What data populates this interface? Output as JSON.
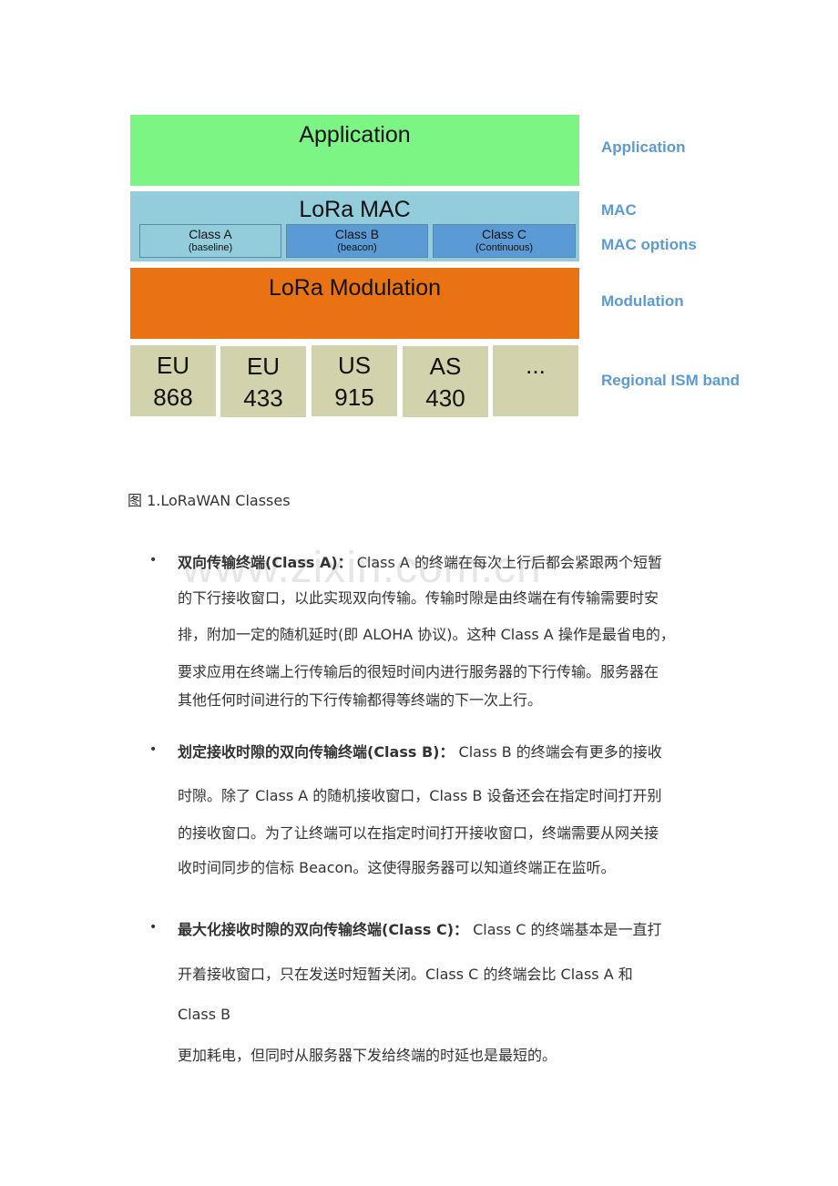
{
  "diagram": {
    "layers": {
      "application": "Application",
      "mac": "LoRa MAC",
      "modulation": "LoRa Modulation"
    },
    "classes": [
      {
        "name": "Class A",
        "sub": "(baseline)"
      },
      {
        "name": "Class B",
        "sub": "(beacon)"
      },
      {
        "name": "Class C",
        "sub": "(Continuous)"
      }
    ],
    "bands": [
      {
        "line1": "EU",
        "line2": "868"
      },
      {
        "line1": "EU",
        "line2": "433"
      },
      {
        "line1": "US",
        "line2": "915"
      },
      {
        "line1": "AS",
        "line2": "430"
      },
      {
        "line1": "...",
        "line2": ""
      }
    ],
    "side_labels": {
      "application": "Application",
      "mac": "MAC",
      "mac_options": "MAC options",
      "modulation": "Modulation",
      "regional": "Regional ISM band"
    },
    "colors": {
      "application": "#7cf584",
      "mac": "#93ccda",
      "class_highlight": "#5b9bd5",
      "modulation": "#e97312",
      "band": "#d2d3ac",
      "side_label": "#5b9bd5"
    }
  },
  "caption": "图 1.LoRaWAN Classes",
  "watermark": "www.zixin.com.cn",
  "bullets": [
    {
      "title": "双向传输终端(Class A)：",
      "lines": [
        " Class A  的终端在每次上行后都会紧跟两个短暂",
        "的下行接收窗口，以此实现双向传输。传输时隙是由终端在有传输需要时安",
        "排，附加一定的随机延时(即 ALOHA 协议)。这种 Class A  操作是最省电的，",
        "要求应用在终端上行传输后的很短时间内进行服务器的下行传输。服务器在",
        "其他任何时间进行的下行传输都得等终端的下一次上行。"
      ]
    },
    {
      "title": "划定接收时隙的双向传输终端(Class B)：",
      "lines": [
        " Class B  的终端会有更多的接收",
        "时隙。除了 Class A  的随机接收窗口，Class B  设备还会在指定时间打开别",
        "的接收窗口。为了让终端可以在指定时间打开接收窗口，终端需要从网关接",
        "收时间同步的信标  Beacon。这使得服务器可以知道终端正在监听。"
      ]
    },
    {
      "title": "最大化接收时隙的双向传输终端(Class C)：",
      "lines": [
        " Class C  的终端基本是一直打",
        "开着接收窗口，只在发送时短暂关闭。Class C  的终端会比  Class A  和",
        "Class B",
        "更加耗电，但同时从服务器下发给终端的时延也是最短的。"
      ]
    }
  ]
}
